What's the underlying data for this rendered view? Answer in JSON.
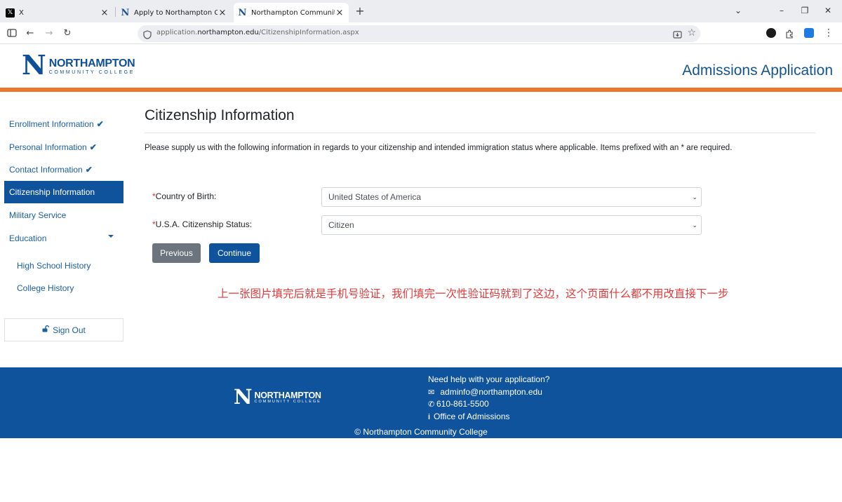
{
  "browser": {
    "tabs": [
      {
        "title": "X",
        "favicon": "x-logo-icon"
      },
      {
        "title": "Apply to Northampton Commu",
        "favicon": "northampton-icon"
      },
      {
        "title": "Northampton Community Coll",
        "favicon": "northampton-icon"
      }
    ],
    "url_domain_prefix": "application.",
    "url_domain": "northampton.edu",
    "url_path": "/CitizenshipInformation.aspx"
  },
  "header": {
    "logo_letter": "N",
    "logo_line1": "NORTHAMPTON",
    "logo_line2": "COMMUNITY COLLEGE",
    "app_title": "Admissions Application"
  },
  "sidebar": {
    "items": [
      {
        "label": "Enrollment Information",
        "completed": true
      },
      {
        "label": "Personal Information",
        "completed": true
      },
      {
        "label": "Contact Information",
        "completed": true
      },
      {
        "label": "Citizenship Information",
        "active": true
      },
      {
        "label": "Military Service"
      },
      {
        "label": "Education",
        "expandable": true
      }
    ],
    "subitems": [
      "High School History",
      "College History"
    ],
    "signout": "Sign Out"
  },
  "main": {
    "title": "Citizenship Information",
    "intro": "Please supply us with the following information in regards to your citizenship and intended immigration status where applicable. Items prefixed with an * are required.",
    "fields": [
      {
        "required_mark": "*",
        "label": "Country of Birth:",
        "value": "United States of America"
      },
      {
        "required_mark": "*",
        "label": "U.S.A. Citizenship Status:",
        "value": "Citizen"
      }
    ],
    "previous_label": "Previous",
    "continue_label": "Continue",
    "annotation": "上一张图片填完后就是手机号验证，我们填完一次性验证码就到了这边，这个页面什么都不用改直接下一步"
  },
  "footer": {
    "help_title": "Need help with your application?",
    "email": "adminfo@northampton.edu",
    "phone": "610-861-5500",
    "office": "Office of Admissions",
    "copyright": "© Northampton Community College"
  },
  "colors": {
    "brand_blue": "#0f539c",
    "accent_orange": "#ea7a2b",
    "required_red": "#d9302c",
    "annotation_red": "#e23a3a"
  }
}
